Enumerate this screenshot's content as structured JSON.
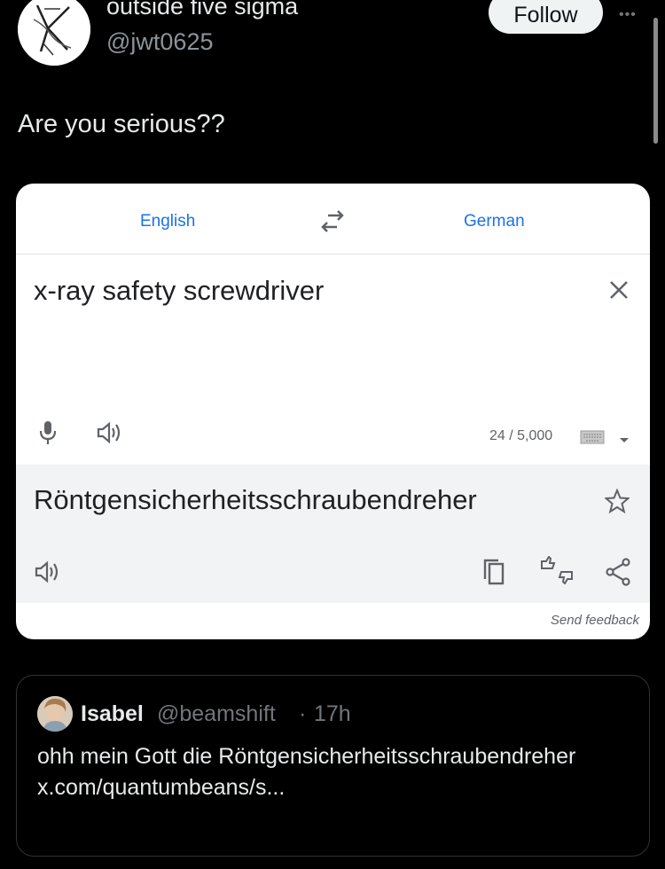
{
  "tweet": {
    "display_name": "outside five sigma",
    "handle": "@jwt0625",
    "follow_label": "Follow",
    "more_label": "•••",
    "text": "Are you serious??"
  },
  "translate": {
    "source_lang": "English",
    "target_lang": "German",
    "source_text": "x-ray safety screwdriver",
    "char_count": "24 / 5,000",
    "result_text": "Röntgensicherheitsschraubendreher",
    "send_feedback": "Send feedback",
    "accent_color": "#1a73e8",
    "icons": [
      "swap-icon",
      "close-icon",
      "mic-icon",
      "speaker-icon",
      "keyboard-icon",
      "dropdown-icon",
      "star-icon",
      "copy-icon",
      "rate-icon",
      "share-icon"
    ]
  },
  "quote": {
    "name": "Isabel",
    "handle": "@beamshift",
    "separator": "·",
    "time": "17h",
    "body": "ohh mein Gott die Röntgensicherheitsschraubendreher x.com/quantumbeans/s..."
  }
}
